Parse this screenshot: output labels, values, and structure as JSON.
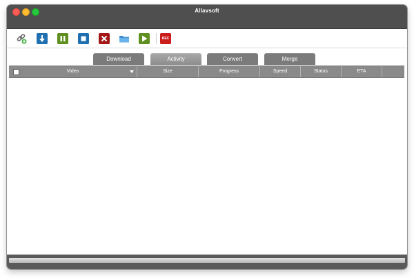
{
  "window": {
    "title": "Allavsoft"
  },
  "toolbar": {
    "buttons": [
      {
        "icon": "link-add-icon",
        "color": "#6d6d6d",
        "accent": "#3fb43f"
      },
      {
        "icon": "download-icon",
        "color": "#1f6fb1"
      },
      {
        "icon": "pause-icon",
        "color": "#5e8f1f"
      },
      {
        "icon": "stop-icon",
        "color": "#1f6fb1"
      },
      {
        "icon": "close-icon",
        "color": "#a31717"
      },
      {
        "icon": "folder-icon",
        "color": "#4ea0dd"
      },
      {
        "icon": "play-icon",
        "color": "#5e8f1f"
      },
      {
        "icon": "record-icon",
        "color": "#cc1d1d",
        "label": "REC"
      }
    ]
  },
  "tabs": [
    {
      "label": "Download",
      "active": false
    },
    {
      "label": "Activity",
      "active": true
    },
    {
      "label": "Convert",
      "active": false
    },
    {
      "label": "Merge",
      "active": false
    }
  ],
  "table": {
    "columns": [
      "Video",
      "Size",
      "Progress",
      "Speed",
      "Status",
      "ETA"
    ]
  }
}
